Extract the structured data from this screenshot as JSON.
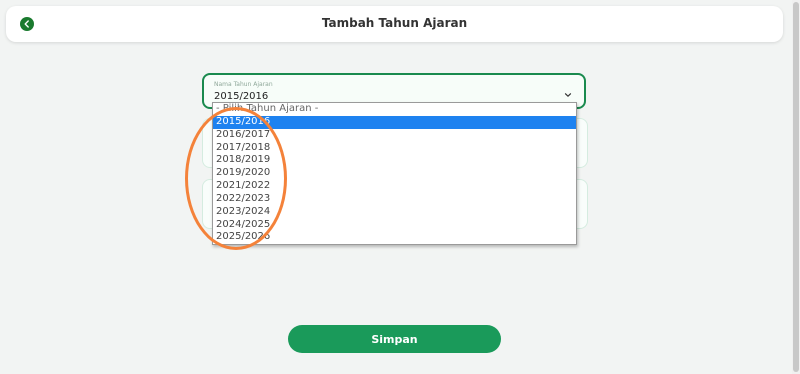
{
  "header": {
    "title": "Tambah Tahun Ajaran"
  },
  "icons": {
    "back": "chevron-left-icon",
    "dropdown": "chevron-down-icon"
  },
  "colors": {
    "primary": "#1a9a5a",
    "selected_option": "#1e82f0",
    "annotation": "#f4823a"
  },
  "form": {
    "year_select": {
      "label": "Nama Tahun Ajaran",
      "value": "2015/2016",
      "options": [
        "- Pilih Tahun Ajaran -",
        "2015/2016",
        "2016/2017",
        "2017/2018",
        "2018/2019",
        "2019/2020",
        "2021/2022",
        "2022/2023",
        "2023/2024",
        "2024/2025",
        "2025/2026"
      ],
      "selected_index": 1
    }
  },
  "actions": {
    "save_label": "Simpan"
  }
}
